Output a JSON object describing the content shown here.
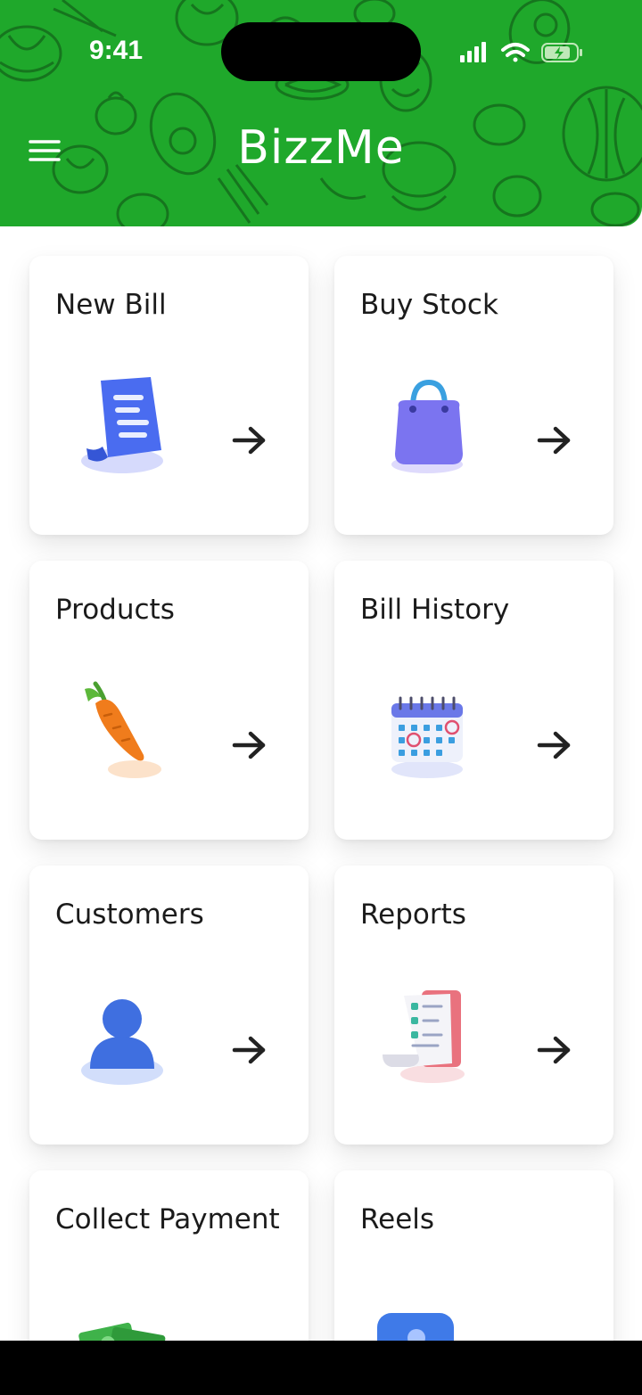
{
  "status_bar": {
    "time": "9:41"
  },
  "header": {
    "title": "BizzMe",
    "background_color": "#1fa82b"
  },
  "cards": [
    {
      "title": "New Bill",
      "icon": "bill-icon"
    },
    {
      "title": "Buy Stock",
      "icon": "shopping-bag-icon"
    },
    {
      "title": "Products",
      "icon": "carrot-icon"
    },
    {
      "title": "Bill History",
      "icon": "calendar-icon"
    },
    {
      "title": "Customers",
      "icon": "user-icon"
    },
    {
      "title": "Reports",
      "icon": "report-icon"
    },
    {
      "title": "Collect Payment",
      "icon": "money-icon"
    },
    {
      "title": "Reels",
      "icon": "reels-icon"
    }
  ]
}
